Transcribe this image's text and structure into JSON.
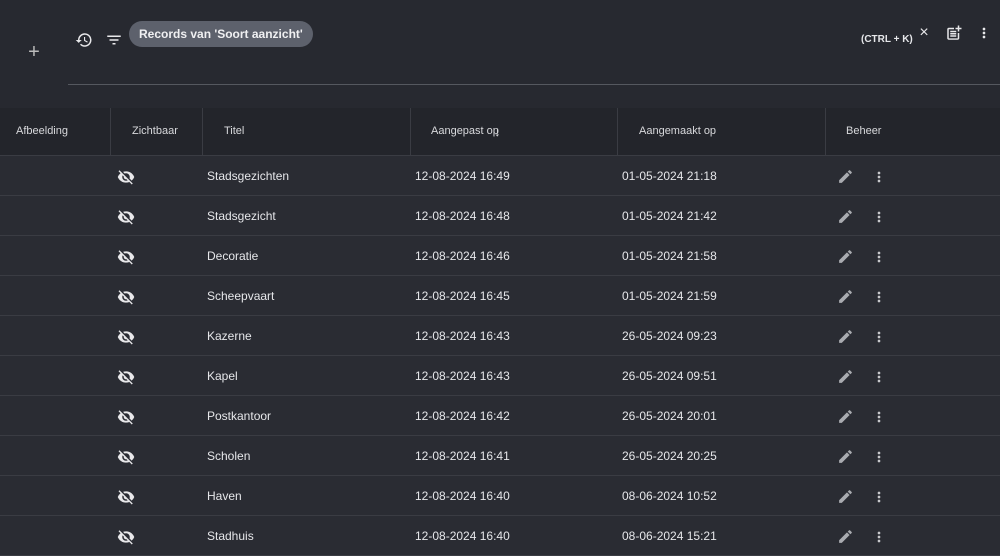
{
  "toolbar": {
    "filter_chip": "Records van 'Soort aanzicht'",
    "shortcut": "(CTRL + K)"
  },
  "columns": [
    "Afbeelding",
    "Zichtbaar",
    "Titel",
    "Aangepast op",
    "Aangemaakt op",
    "Beheer"
  ],
  "rows": [
    {
      "title": "Stadsgezichten",
      "modified": "12-08-2024 16:49",
      "created": "01-05-2024 21:18"
    },
    {
      "title": "Stadsgezicht",
      "modified": "12-08-2024 16:48",
      "created": "01-05-2024 21:42"
    },
    {
      "title": "Decoratie",
      "modified": "12-08-2024 16:46",
      "created": "01-05-2024 21:58"
    },
    {
      "title": "Scheepvaart",
      "modified": "12-08-2024 16:45",
      "created": "01-05-2024 21:59"
    },
    {
      "title": "Kazerne",
      "modified": "12-08-2024 16:43",
      "created": "26-05-2024 09:23"
    },
    {
      "title": "Kapel",
      "modified": "12-08-2024 16:43",
      "created": "26-05-2024 09:51"
    },
    {
      "title": "Postkantoor",
      "modified": "12-08-2024 16:42",
      "created": "26-05-2024 20:01"
    },
    {
      "title": "Scholen",
      "modified": "12-08-2024 16:41",
      "created": "26-05-2024 20:25"
    },
    {
      "title": "Haven",
      "modified": "12-08-2024 16:40",
      "created": "08-06-2024 10:52"
    },
    {
      "title": "Stadhuis",
      "modified": "12-08-2024 16:40",
      "created": "08-06-2024 15:21"
    }
  ]
}
